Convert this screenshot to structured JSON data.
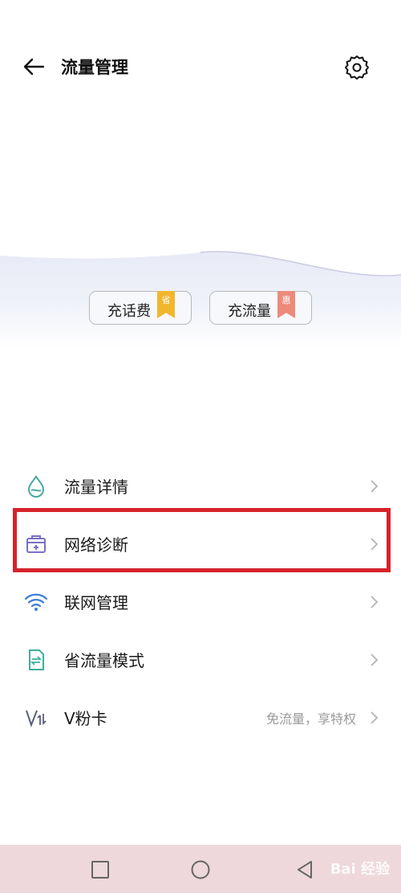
{
  "header": {
    "title": "流量管理"
  },
  "promo": {
    "recharge_fee": {
      "label": "充话费",
      "tag": "省",
      "tag_color": "#f2b62e"
    },
    "recharge_data": {
      "label": "充流量",
      "tag": "惠",
      "tag_color": "#ee8a7a"
    }
  },
  "list": {
    "items": [
      {
        "label": "流量详情",
        "icon": "water-drop-icon"
      },
      {
        "label": "网络诊断",
        "icon": "toolbox-icon"
      },
      {
        "label": "联网管理",
        "icon": "wifi-icon"
      },
      {
        "label": "省流量模式",
        "icon": "data-saver-icon"
      },
      {
        "label": "V粉卡",
        "icon": "v-card-icon",
        "subtitle": "免流量，享特权"
      }
    ]
  },
  "highlight": {
    "color": "#d6232b"
  },
  "nav": {
    "watermark": "Bai 经验"
  }
}
